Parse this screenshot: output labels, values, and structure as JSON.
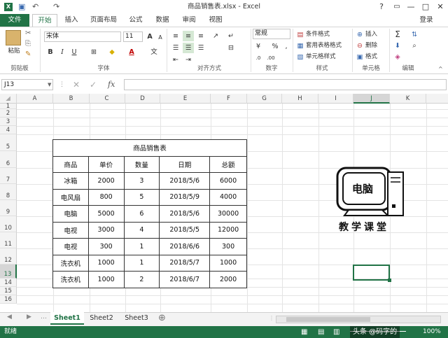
{
  "titlebar": {
    "title": "商品销售表.xlsx - Excel",
    "help": "?",
    "minimize": "—",
    "restore": "□",
    "close": "✕"
  },
  "tabs": {
    "file": "文件",
    "home": "开始",
    "insert": "插入",
    "layout": "页面布局",
    "formulas": "公式",
    "data": "数据",
    "review": "审阅",
    "view": "视图",
    "login": "登录"
  },
  "ribbon": {
    "clipboard": {
      "paste": "粘贴",
      "label": "剪贴板"
    },
    "font": {
      "name": "宋体",
      "size": "11",
      "label": "字体",
      "bold": "B",
      "italic": "I",
      "underline": "U",
      "grow": "A",
      "shrink": "A"
    },
    "alignment": {
      "label": "对齐方式"
    },
    "number": {
      "format": "常规",
      "label": "数字"
    },
    "styles": {
      "conditional": "条件格式",
      "table": "套用表格格式",
      "cell": "单元格样式",
      "label": "样式"
    },
    "cells": {
      "insert": "插入",
      "delete": "删除",
      "format": "格式",
      "label": "单元格"
    },
    "editing": {
      "label": "编辑"
    }
  },
  "formula": {
    "namebox": "J13",
    "fx": "fx",
    "value": ""
  },
  "columns": [
    "A",
    "B",
    "C",
    "D",
    "E",
    "F",
    "G",
    "H",
    "I",
    "J",
    "K"
  ],
  "rows": [
    "1",
    "2",
    "3",
    "4",
    "5",
    "6",
    "7",
    "8",
    "9",
    "10",
    "11",
    "12",
    "13",
    "14",
    "15",
    "16"
  ],
  "table": {
    "title": "商品销售表",
    "headers": [
      "商品",
      "单价",
      "数量",
      "日期",
      "总额"
    ],
    "rows": [
      [
        "冰箱",
        "2000",
        "3",
        "2018/5/6",
        "6000"
      ],
      [
        "电风扇",
        "800",
        "5",
        "2018/5/9",
        "4000"
      ],
      [
        "电脑",
        "5000",
        "6",
        "2018/5/6",
        "30000"
      ],
      [
        "电视",
        "3000",
        "4",
        "2018/5/5",
        "12000"
      ],
      [
        "电视",
        "300",
        "1",
        "2018/6/6",
        "300"
      ],
      [
        "洗衣机",
        "1000",
        "1",
        "2018/5/7",
        "1000"
      ],
      [
        "洗衣机",
        "1000",
        "2",
        "2018/6/7",
        "2000"
      ]
    ]
  },
  "picture": {
    "screen_text": "电脑",
    "caption": "教学课堂"
  },
  "sheets": [
    "Sheet1",
    "Sheet2",
    "Sheet3"
  ],
  "status": {
    "ready": "就绪",
    "zoom": "100%",
    "watermark": "头条 @码字的"
  }
}
